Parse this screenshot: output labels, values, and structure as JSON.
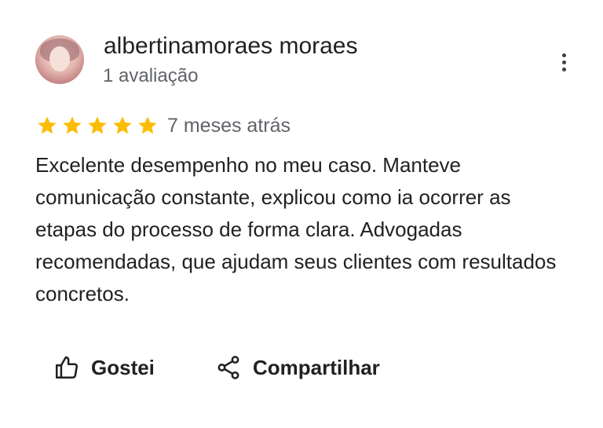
{
  "reviewer": {
    "name": "albertinamoraes moraes",
    "review_count": "1 avaliação"
  },
  "rating": {
    "stars": 5,
    "max": 5,
    "star_color": "#fbbc04"
  },
  "review": {
    "time_ago": "7 meses atrás",
    "text": "Excelente desempenho no meu caso. Manteve comunicação constante, explicou como ia ocorrer as etapas do processo de forma clara. Advogadas recomendadas, que ajudam seus clientes com resultados concretos."
  },
  "actions": {
    "like_label": "Gostei",
    "like_icon": "thumbs-up-icon",
    "share_label": "Compartilhar",
    "share_icon": "share-icon"
  },
  "menu": {
    "icon": "more-vert-icon"
  }
}
